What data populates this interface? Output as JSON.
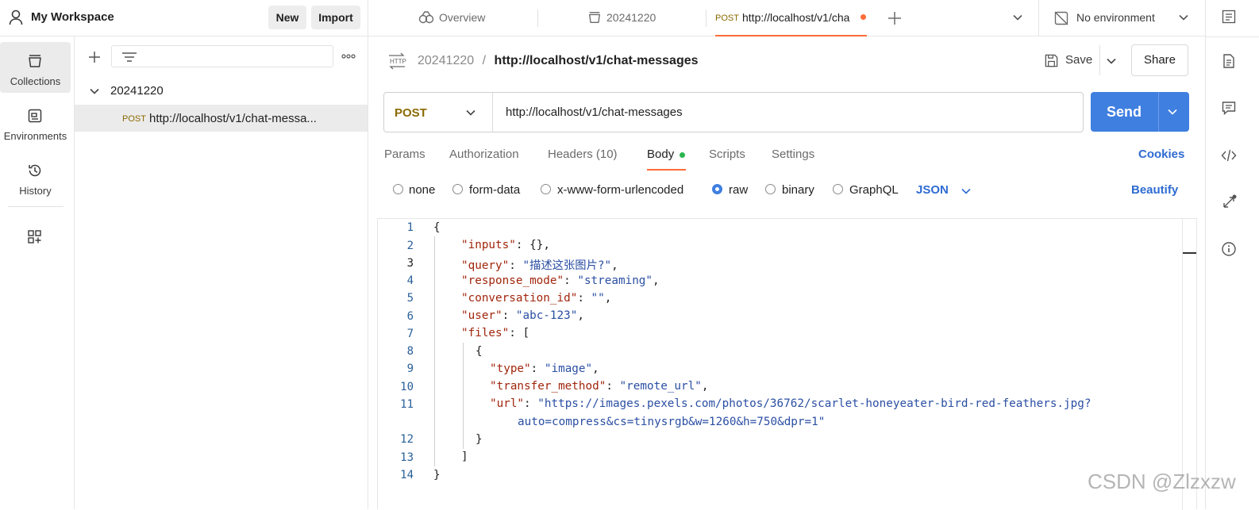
{
  "workspace": {
    "title": "My Workspace",
    "new_label": "New",
    "import_label": "Import"
  },
  "rail": {
    "collections": "Collections",
    "environments": "Environments",
    "history": "History"
  },
  "sidebar": {
    "folder": "20241220",
    "request_method": "POST",
    "request_name": "http://localhost/v1/chat-messa..."
  },
  "tabs": {
    "overview": "Overview",
    "folder_tab": "20241220",
    "active_method": "POST",
    "active_url": "http://localhost/v1/cha",
    "environment": "No environment"
  },
  "breadcrumb": {
    "collection": "20241220",
    "separator": "/",
    "request": "http://localhost/v1/chat-messages"
  },
  "actions": {
    "save": "Save",
    "share": "Share"
  },
  "request": {
    "method": "POST",
    "url": "http://localhost/v1/chat-messages",
    "send": "Send"
  },
  "subtabs": {
    "params": "Params",
    "authorization": "Authorization",
    "headers": "Headers (10)",
    "body": "Body",
    "scripts": "Scripts",
    "settings": "Settings",
    "cookies": "Cookies"
  },
  "body_types": {
    "none": "none",
    "form_data": "form-data",
    "urlencoded": "x-www-form-urlencoded",
    "raw": "raw",
    "binary": "binary",
    "graphql": "GraphQL",
    "format": "JSON",
    "beautify": "Beautify"
  },
  "editor": {
    "line_numbers": [
      "1",
      "2",
      "3",
      "4",
      "5",
      "6",
      "7",
      "8",
      "9",
      "10",
      "11",
      "12",
      "13",
      "14"
    ],
    "brace_open": "{",
    "brace_close": "}",
    "key_inputs": "\"inputs\"",
    "val_inputs": "{}",
    "key_query": "\"query\"",
    "val_query": "\"描述这张图片?\"",
    "key_response_mode": "\"response_mode\"",
    "val_response_mode": "\"streaming\"",
    "key_conversation_id": "\"conversation_id\"",
    "val_conversation_id": "\"\"",
    "key_user": "\"user\"",
    "val_user": "\"abc-123\"",
    "key_files": "\"files\"",
    "key_type": "\"type\"",
    "val_type": "\"image\"",
    "key_transfer_method": "\"transfer_method\"",
    "val_transfer_method": "\"remote_url\"",
    "key_url": "\"url\"",
    "val_url_line1": "\"https://images.pexels.com/photos/36762/scarlet-honeyeater-bird-red-feathers.jpg?",
    "val_url_line2": "auto=compress&cs=tinysrgb&w=1260&h=750&dpr=1\""
  },
  "watermark": "CSDN @Zlzxzw",
  "colors": {
    "accent": "#ff6c37",
    "send": "#3f7fe0",
    "link": "#2e6bd1",
    "body_dot": "#2db550"
  }
}
